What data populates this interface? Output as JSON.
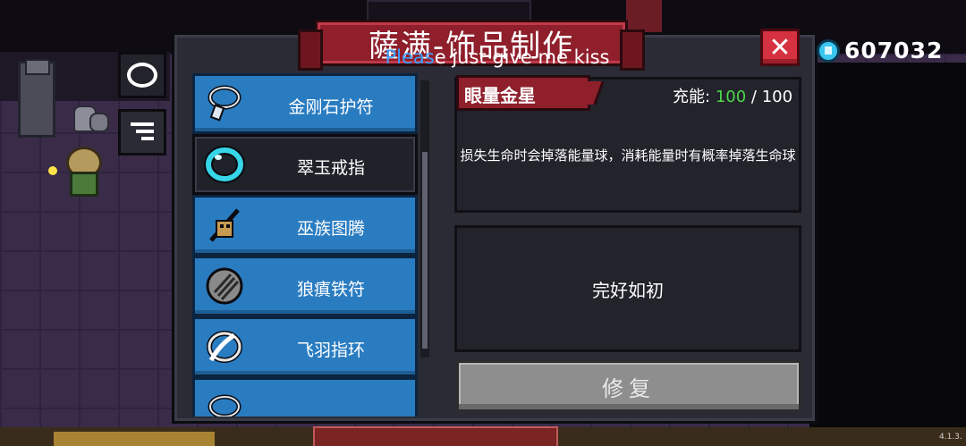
{
  "header": {
    "title": "薩满-饰品制作",
    "subtitle_highlight": "Pleas",
    "subtitle_rest": "e just give me kiss",
    "close_label": "✕"
  },
  "currency": {
    "icon": "gem-icon",
    "amount": "607032"
  },
  "tabs": [
    {
      "icon": "ring-icon"
    },
    {
      "icon": "list-icon"
    }
  ],
  "accessories": [
    {
      "label": "金刚石护符",
      "icon": "amulet-icon",
      "selected": false
    },
    {
      "label": "翠玉戒指",
      "icon": "jade-ring-icon",
      "selected": true
    },
    {
      "label": "巫族图腾",
      "icon": "totem-icon",
      "selected": false
    },
    {
      "label": "狼瘨铁符",
      "icon": "wolf-claw-icon",
      "selected": false
    },
    {
      "label": "飞羽指环",
      "icon": "feather-ring-icon",
      "selected": false
    },
    {
      "label": "",
      "icon": "amulet-icon",
      "selected": false
    }
  ],
  "detail": {
    "tag": "眼量金星",
    "charge_label": "充能:",
    "charge_current": "100",
    "charge_sep": "/",
    "charge_max": "100",
    "description": "损失生命时会掉落能量球，消耗能量时有概率掉落生命球",
    "status": "完好如初",
    "repair_label": "修复"
  },
  "version": "4.1.3.",
  "colors": {
    "panel": "#2a2b34",
    "item": "#2a7cc1",
    "banner": "#8e1f2b",
    "close": "#d63140",
    "charge": "#4dd84a"
  }
}
